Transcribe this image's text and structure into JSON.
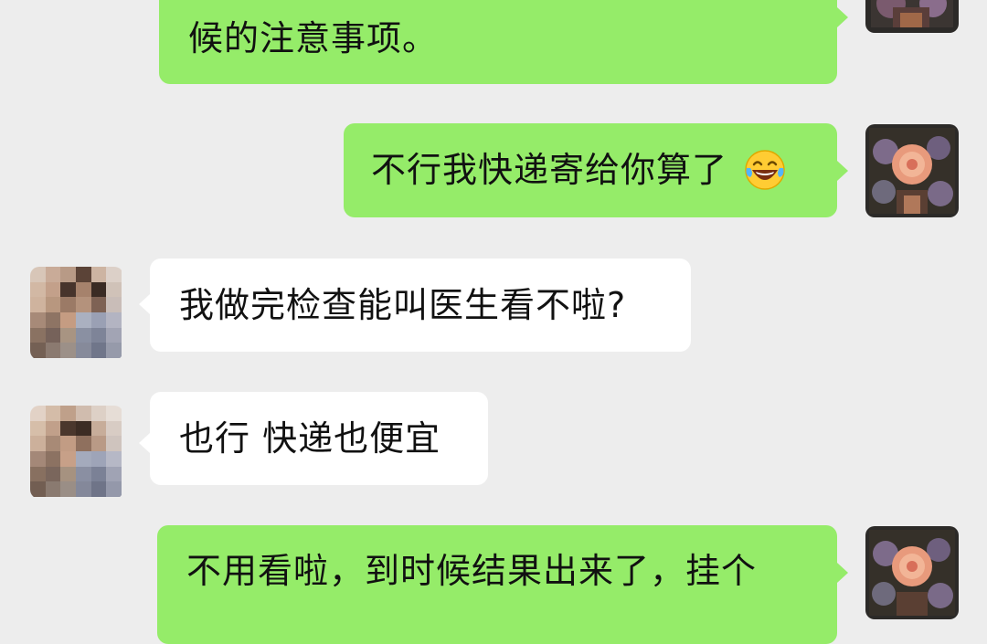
{
  "chat": {
    "messages": [
      {
        "sender": "me",
        "lines": [
          "候的注意事项。"
        ]
      },
      {
        "sender": "me",
        "text": "不行我快递寄给你算了",
        "emoji": "laughing-tears-emoji"
      },
      {
        "sender": "other",
        "text": "我做完检查能叫医生看不啦?"
      },
      {
        "sender": "other",
        "text": "也行 快递也便宜"
      },
      {
        "sender": "me",
        "lines": [
          "不用看啦，到时候结果出来了，挂个"
        ]
      }
    ]
  },
  "colors": {
    "background": "#ededed",
    "my_bubble": "#95ec69",
    "their_bubble": "#ffffff"
  },
  "icons": {
    "my_avatar": "flower-avatar-icon",
    "their_avatar": "pixelated-avatar"
  }
}
